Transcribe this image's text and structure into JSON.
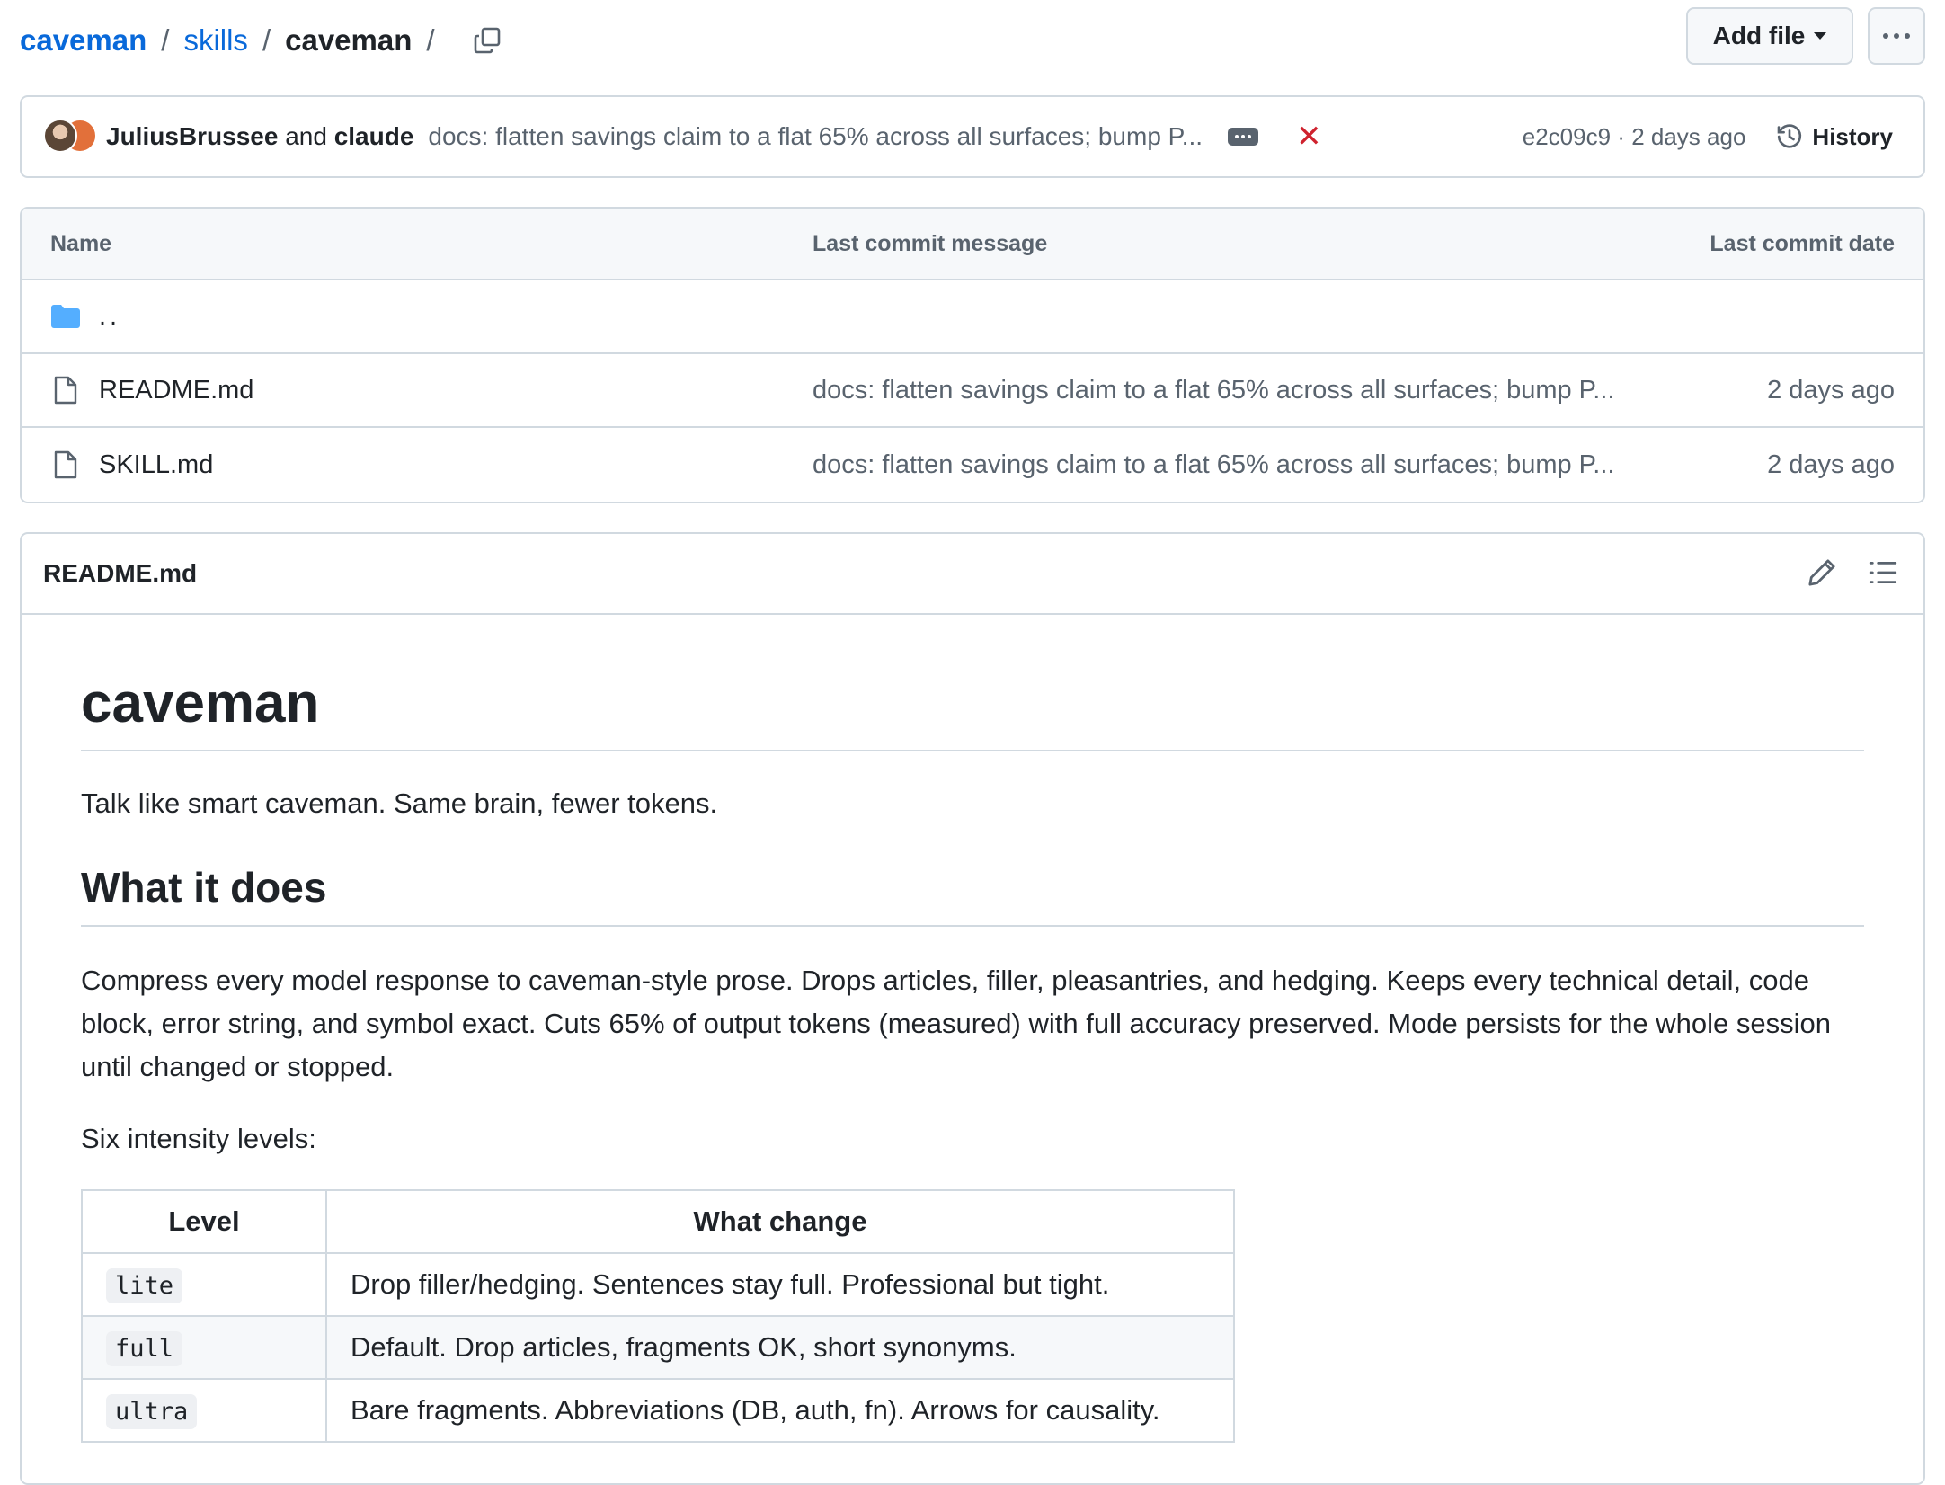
{
  "breadcrumb": {
    "repo": "caveman",
    "folder": "skills",
    "current": "caveman",
    "separator": "/"
  },
  "actions": {
    "add_file_label": "Add file"
  },
  "commit": {
    "author_1": "JuliusBrussee",
    "conjunction": "and",
    "author_2": "claude",
    "message": "docs: flatten savings claim to a flat 65% across all surfaces; bump P...",
    "sha": "e2c09c9",
    "age": "2 days ago",
    "meta_sep": "·",
    "status_icon": "x-icon",
    "history_label": "History"
  },
  "file_table": {
    "headers": {
      "name": "Name",
      "message": "Last commit message",
      "date": "Last commit date"
    },
    "parent_label": "..",
    "files": [
      {
        "name": "README.md",
        "message": "docs: flatten savings claim to a flat 65% across all surfaces; bump P...",
        "date": "2 days ago"
      },
      {
        "name": "SKILL.md",
        "message": "docs: flatten savings claim to a flat 65% across all surfaces; bump P...",
        "date": "2 days ago"
      }
    ]
  },
  "readme": {
    "filename": "README.md",
    "h1": "caveman",
    "tagline": "Talk like smart caveman. Same brain, fewer tokens.",
    "h2": "What it does",
    "description": "Compress every model response to caveman-style prose. Drops articles, filler, pleasantries, and hedging. Keeps every technical detail, code block, error string, and symbol exact. Cuts 65% of output tokens (measured) with full accuracy preserved. Mode persists for the whole session until changed or stopped.",
    "levels_intro": "Six intensity levels:",
    "table": {
      "headers": [
        "Level",
        "What change"
      ],
      "rows": [
        {
          "level": "lite",
          "change": "Drop filler/hedging. Sentences stay full. Professional but tight."
        },
        {
          "level": "full",
          "change": "Default. Drop articles, fragments OK, short synonyms."
        },
        {
          "level": "ultra",
          "change": "Bare fragments. Abbreviations (DB, auth, fn). Arrows for causality."
        }
      ]
    }
  },
  "colors": {
    "link": "#0969da",
    "text": "#1f2328",
    "muted": "#59636e",
    "border": "#d1d9e0",
    "subtle_bg": "#f6f8fa",
    "danger": "#cf222e",
    "folder": "#54aeff"
  }
}
